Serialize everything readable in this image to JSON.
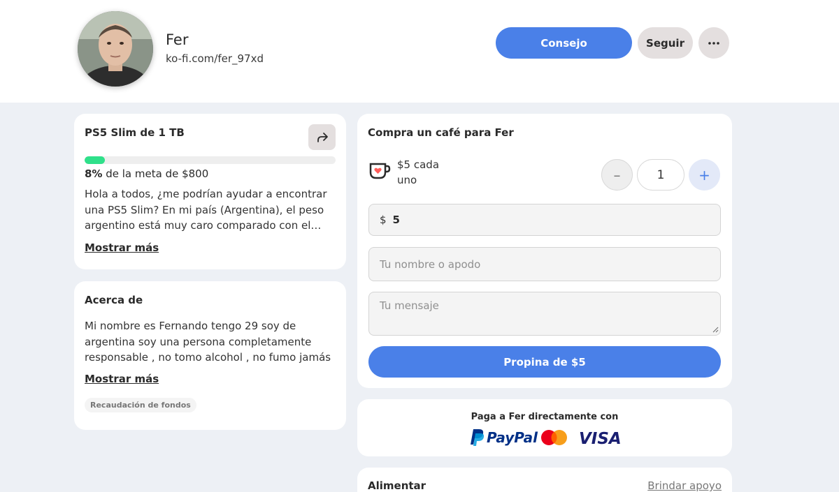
{
  "profile": {
    "name": "Fer",
    "url": "ko-fi.com/fer_97xd"
  },
  "header_buttons": {
    "tip_label": "Consejo",
    "follow_label": "Seguir",
    "more_label": "•••"
  },
  "goal": {
    "title": "PS5 Slim de 1 TB",
    "progress_fraction": 0.08,
    "percent": "8%",
    "meta_text": " de la meta de $800",
    "description": "Hola a todos, ¿me podrían ayudar a encontrar una PS5 Slim? En mi país (Argentina), el peso argentino está muy caro comparado con el dólar",
    "show_more": "Mostrar más"
  },
  "about": {
    "title": "Acerca de",
    "description": "Mi nombre es Fernando tengo 29 soy de argentina soy una persona completamente responsable , no tomo alcohol , no fumo jamás",
    "show_more": "Mostrar más",
    "tag": "Recaudación de fondos"
  },
  "coffee": {
    "title": "Compra un café para Fer",
    "price_text": "$5 cada uno",
    "minus": "–",
    "quantity": "1",
    "plus": "+",
    "currency": "$",
    "amount": "5",
    "name_placeholder": "Tu nombre o apodo",
    "message_placeholder": "Tu mensaje",
    "submit_label": "Propina de $5"
  },
  "pay": {
    "title": "Paga a Fer directamente con",
    "paypal": "PayPal",
    "visa": "VISA"
  },
  "feed": {
    "title": "Alimentar",
    "link": "Brindar apoyo"
  },
  "colors": {
    "accent": "#4a80e8",
    "progress": "#2fe08a",
    "page_bg": "#edf0f5",
    "paypal_dark": "#003087",
    "paypal_light": "#009cde",
    "visa": "#1a1f71",
    "kofi_orange": "#ff5e5b"
  },
  "icons": {
    "share": "share-arrow-icon",
    "cup": "kofi-cup-icon",
    "more": "ellipsis-icon"
  }
}
